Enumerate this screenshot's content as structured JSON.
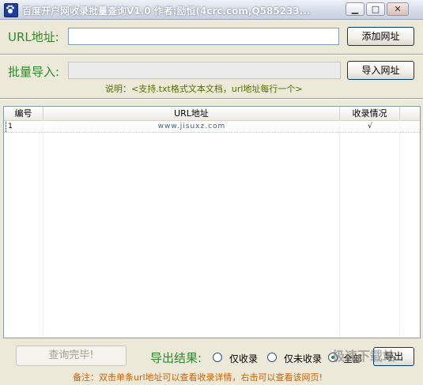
{
  "window": {
    "title": "百度开户网收录批量查询V1.0  作者:励恒(4crc.com,Q585233...",
    "minimize_icon": "minimize-icon",
    "maximize_icon": "maximize-icon",
    "close_icon": "close-icon"
  },
  "url_row": {
    "label": "URL地址:",
    "input_value": "",
    "add_button": "添加网址"
  },
  "batch_row": {
    "label": "批量导入:",
    "input_value": "",
    "import_button": "导入网址",
    "hint": "说明：<支持.txt格式文本文档，url地址每行一个>"
  },
  "list": {
    "columns": [
      "编号",
      "URL地址",
      "收录情况"
    ],
    "rows": [
      {
        "index": "1",
        "url": "www.jisuxz.com",
        "status": "√"
      }
    ]
  },
  "bottom": {
    "query_button": "查询完毕!",
    "export_label": "导出结果:",
    "radio_included": "仅收录",
    "radio_not_included": "仅未收录",
    "radio_all": "全部",
    "selected": "全部",
    "export_button": "导出",
    "note": "备注：双击单条url地址可以查看收录详情，右击可以查看该网页!",
    "watermark": "极速下载站"
  },
  "colors": {
    "label_green": "#2b8a2b",
    "hint_olive": "#5a6b00",
    "note_orange": "#d06000"
  }
}
